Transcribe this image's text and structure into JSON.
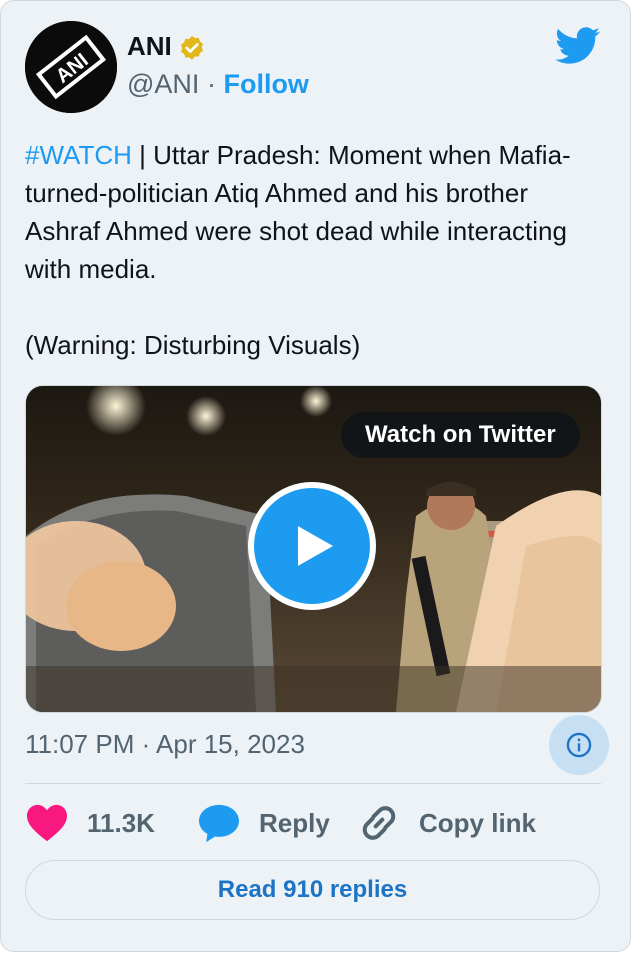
{
  "author": {
    "name": "ANI",
    "handle": "@ANI",
    "separator": "·",
    "follow_label": "Follow",
    "logo_text": "ANI"
  },
  "icons": {
    "verified": "verified-badge-icon",
    "brand": "twitter-bird-icon",
    "play": "play-icon",
    "info": "info-icon",
    "like": "heart-icon",
    "reply": "reply-bubble-icon",
    "copy": "link-icon"
  },
  "tweet": {
    "hashtag": "#WATCH",
    "text": " | Uttar Pradesh: Moment when Mafia-turned-politician Atiq Ahmed and his brother Ashraf Ahmed were shot dead while interacting with media.\n\n(Warning: Disturbing Visuals)"
  },
  "media": {
    "watch_label": "Watch on Twitter"
  },
  "timestamp": "11:07 PM · Apr 15, 2023",
  "actions": {
    "likes": "11.3K",
    "reply_label": "Reply",
    "copy_label": "Copy link"
  },
  "read_replies_label": "Read 910 replies",
  "colors": {
    "accent": "#1d9bf0",
    "heart": "#f91880",
    "card_bg": "#edf2f6",
    "verified_gold": "#e2b719"
  }
}
